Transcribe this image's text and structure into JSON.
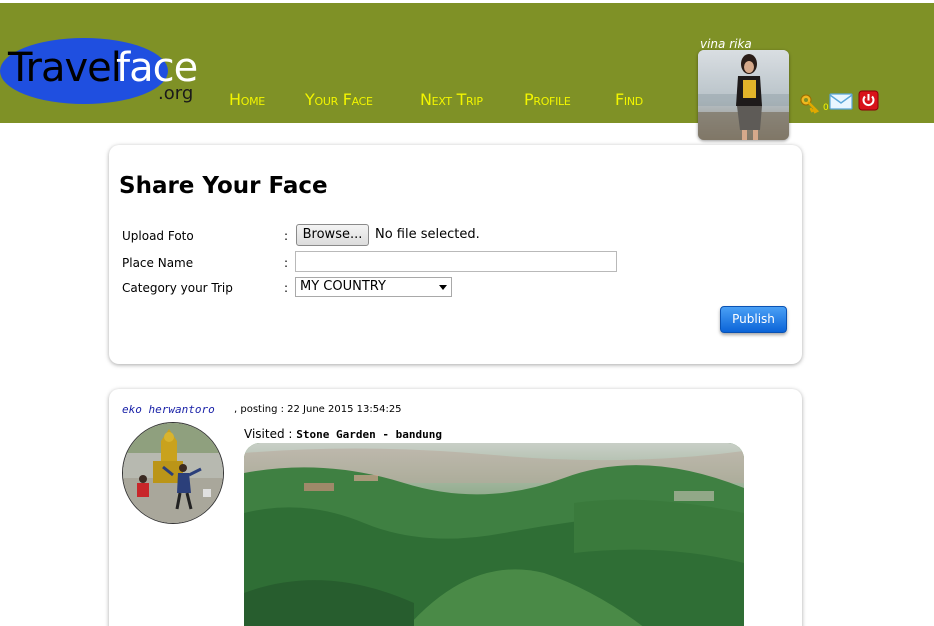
{
  "brand": {
    "logo_part1": "Travel",
    "logo_part2": "face",
    "logo_suffix": ".org"
  },
  "nav": {
    "items": [
      {
        "label": "Home"
      },
      {
        "label": "Your Face"
      },
      {
        "label": "Next Trip"
      },
      {
        "label": "Profile"
      },
      {
        "label": "Find"
      }
    ]
  },
  "user": {
    "name": "vina rika",
    "notification_count": "0"
  },
  "share_form": {
    "title": "Share Your Face",
    "upload_label": "Upload Foto",
    "place_label": "Place Name",
    "category_label": "Category your Trip",
    "separator": ":",
    "browse_label": "Browse...",
    "file_status": "No file selected.",
    "place_value": "",
    "category_selected": "MY COUNTRY",
    "publish_label": "Publish"
  },
  "post": {
    "author": "eko herwantoro",
    "meta": ", posting : 22 June 2015 13:54:25",
    "visited_label": "Visited : ",
    "visited_place": "Stone Garden - bandung"
  },
  "colors": {
    "header_bg": "#7f9126",
    "nav_text": "#f2f500",
    "logo_blue": "#1f4fe0",
    "publish_blue": "#0b64d8",
    "author_link": "#1b23a8"
  },
  "icons": [
    "key-icon",
    "mail-icon",
    "power-icon",
    "file-upload",
    "chevron-down-icon"
  ]
}
